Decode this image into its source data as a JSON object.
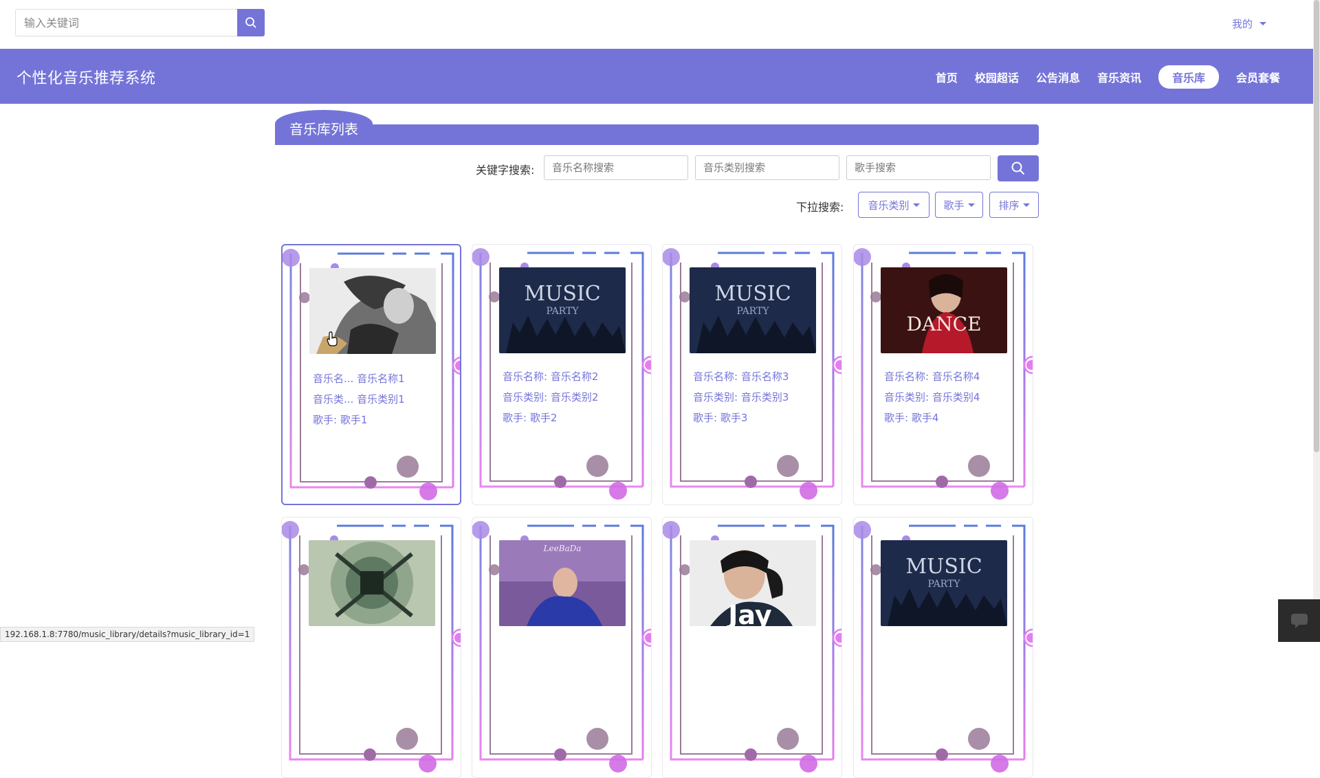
{
  "top": {
    "search_placeholder": "输入关键词",
    "mine_label": "我的"
  },
  "header": {
    "title": "个性化音乐推荐系统",
    "nav": [
      {
        "label": "首页",
        "active": false
      },
      {
        "label": "校园超话",
        "active": false
      },
      {
        "label": "公告消息",
        "active": false
      },
      {
        "label": "音乐资讯",
        "active": false
      },
      {
        "label": "音乐库",
        "active": true
      },
      {
        "label": "会员套餐",
        "active": false
      }
    ]
  },
  "section": {
    "title": "音乐库列表"
  },
  "filters": {
    "keyword_label": "关键字搜索:",
    "name_placeholder": "音乐名称搜索",
    "category_placeholder": "音乐类别搜索",
    "singer_placeholder": "歌手搜索",
    "dropdown_label": "下拉搜索:",
    "dropdowns": [
      "音乐类别",
      "歌手",
      "排序"
    ]
  },
  "cards": [
    {
      "name_label": "音乐名...",
      "name": "音乐名称1",
      "category_label": "音乐类...",
      "category": "音乐类别1",
      "singer_label": "歌手:",
      "singer": "歌手1",
      "image": "portrait-woman-bw"
    },
    {
      "name_label": "音乐名称:",
      "name": "音乐名称2",
      "category_label": "音乐类别:",
      "category": "音乐类别2",
      "singer_label": "歌手:",
      "singer": "歌手2",
      "image": "music-party-poster"
    },
    {
      "name_label": "音乐名称:",
      "name": "音乐名称3",
      "category_label": "音乐类别:",
      "category": "音乐类别3",
      "singer_label": "歌手:",
      "singer": "歌手3",
      "image": "music-party-poster"
    },
    {
      "name_label": "音乐名称:",
      "name": "音乐名称4",
      "category_label": "音乐类别:",
      "category": "音乐类别4",
      "singer_label": "歌手:",
      "singer": "歌手4",
      "image": "dance-poster-red"
    },
    {
      "image": "guitar-sunburst"
    },
    {
      "image": "portrait-woman-blue"
    },
    {
      "image": "jay-album"
    },
    {
      "image": "music-party-poster"
    }
  ],
  "row2_images_text": [
    "LeeBaDa",
    "Jay"
  ],
  "poster_text": {
    "music": "MUSIC",
    "party": "PARTY",
    "dance": "DANCE"
  },
  "status_url": "192.168.1.8:7780/music_library/details?music_library_id=1",
  "colors": {
    "accent": "#7474d8",
    "deco_blue": "#5b7bdc",
    "deco_pink": "#e47ef0",
    "deco_mauve": "#9a7a98"
  }
}
